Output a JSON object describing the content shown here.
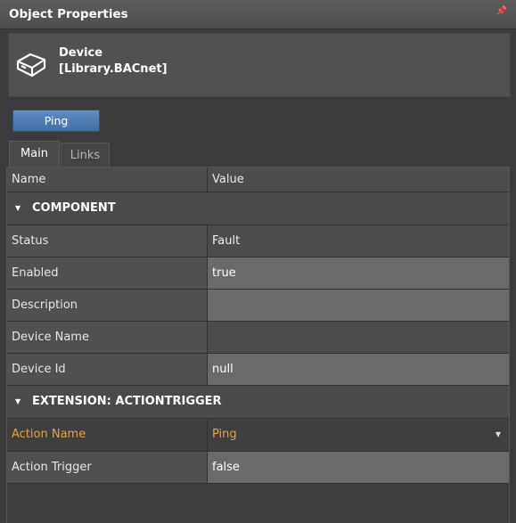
{
  "panel": {
    "title": "Object Properties",
    "pin_icon": "pin-icon"
  },
  "header": {
    "icon": "device-icon",
    "name_line1": "Device",
    "name_line2": "[Library.BACnet]"
  },
  "ping_button": {
    "label": "Ping"
  },
  "tabs": [
    {
      "label": "Main",
      "active": true
    },
    {
      "label": "Links",
      "active": false
    }
  ],
  "grid": {
    "columns": {
      "name": "Name",
      "value": "Value"
    },
    "sections": [
      {
        "label": "COMPONENT",
        "rows": [
          {
            "name": "Status",
            "value": "Fault",
            "editable": false
          },
          {
            "name": "Enabled",
            "value": "true",
            "editable": true
          },
          {
            "name": "Description",
            "value": "",
            "editable": true
          },
          {
            "name": "Device Name",
            "value": "",
            "editable": false
          },
          {
            "name": "Device Id",
            "value": "null",
            "editable": true
          }
        ]
      },
      {
        "label": "EXTENSION: ACTIONTRIGGER",
        "rows": [
          {
            "name": "Action Name",
            "value": "Ping",
            "selected": true,
            "dropdown": true
          },
          {
            "name": "Action Trigger",
            "value": "false",
            "editable": true
          }
        ]
      }
    ]
  },
  "colors": {
    "accent_selected": "#e8a33c",
    "button_blue": "#4f7fb8"
  }
}
